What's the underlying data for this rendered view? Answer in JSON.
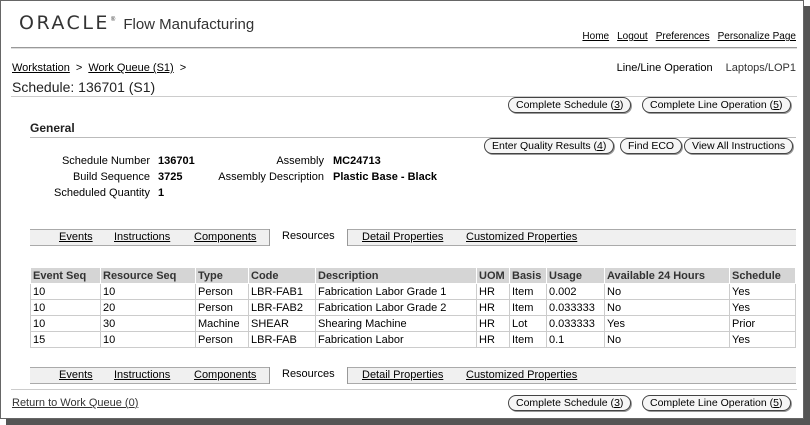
{
  "brand": {
    "oracle": "ORACLE",
    "reg": "®",
    "product": "Flow Manufacturing"
  },
  "global_links": [
    "Home",
    "Logout",
    "Preferences",
    "Personalize Page"
  ],
  "breadcrumb": {
    "items": [
      "Workstation",
      "Work Queue (S1)"
    ],
    "sep": ">"
  },
  "line_op": {
    "label": "Line/Line Operation",
    "value": "Laptops/LOP1"
  },
  "page_title": "Schedule: 136701 (S1)",
  "buttons": {
    "complete_schedule_pre": "Complete Schedule (",
    "complete_schedule_key": "3",
    "complete_line_op_pre": "Complete Line Operation (",
    "complete_line_op_key": "5",
    "close": ")",
    "enter_quality_pre": "Enter Quality Results (",
    "enter_quality_key": "4",
    "find_eco": "Find ECO",
    "view_all": "View All Instructions"
  },
  "general": {
    "title": "General",
    "schedule_number_label": "Schedule Number",
    "schedule_number": "136701",
    "build_sequence_label": "Build Sequence",
    "build_sequence": "3725",
    "scheduled_quantity_label": "Scheduled Quantity",
    "scheduled_quantity": "1",
    "assembly_label": "Assembly",
    "assembly": "MC24713",
    "assembly_desc_label": "Assembly Description",
    "assembly_desc": "Plastic Base - Black"
  },
  "tabs": [
    "Events",
    "Instructions",
    "Components",
    "Resources",
    "Detail Properties",
    "Customized Properties"
  ],
  "table": {
    "headers": [
      "Event Seq",
      "Resource Seq",
      "Type",
      "Code",
      "Description",
      "UOM",
      "Basis",
      "Usage",
      "Available 24 Hours",
      "Schedule"
    ],
    "rows": [
      [
        "10",
        "10",
        "Person",
        "LBR-FAB1",
        "Fabrication Labor Grade 1",
        "HR",
        "Item",
        "0.002",
        "No",
        "Yes"
      ],
      [
        "10",
        "20",
        "Person",
        "LBR-FAB2",
        "Fabrication Labor Grade 2",
        "HR",
        "Item",
        "0.033333",
        "No",
        "Yes"
      ],
      [
        "10",
        "30",
        "Machine",
        "SHEAR",
        "Shearing Machine",
        "HR",
        "Lot",
        "0.033333",
        "Yes",
        "Prior"
      ],
      [
        "15",
        "10",
        "Person",
        "LBR-FAB",
        "Fabrication Labor",
        "HR",
        "Item",
        "0.1",
        "No",
        "Yes"
      ]
    ]
  },
  "return_link": {
    "pre": "Return to Work Queue (",
    "key": "0",
    "post": ")"
  }
}
